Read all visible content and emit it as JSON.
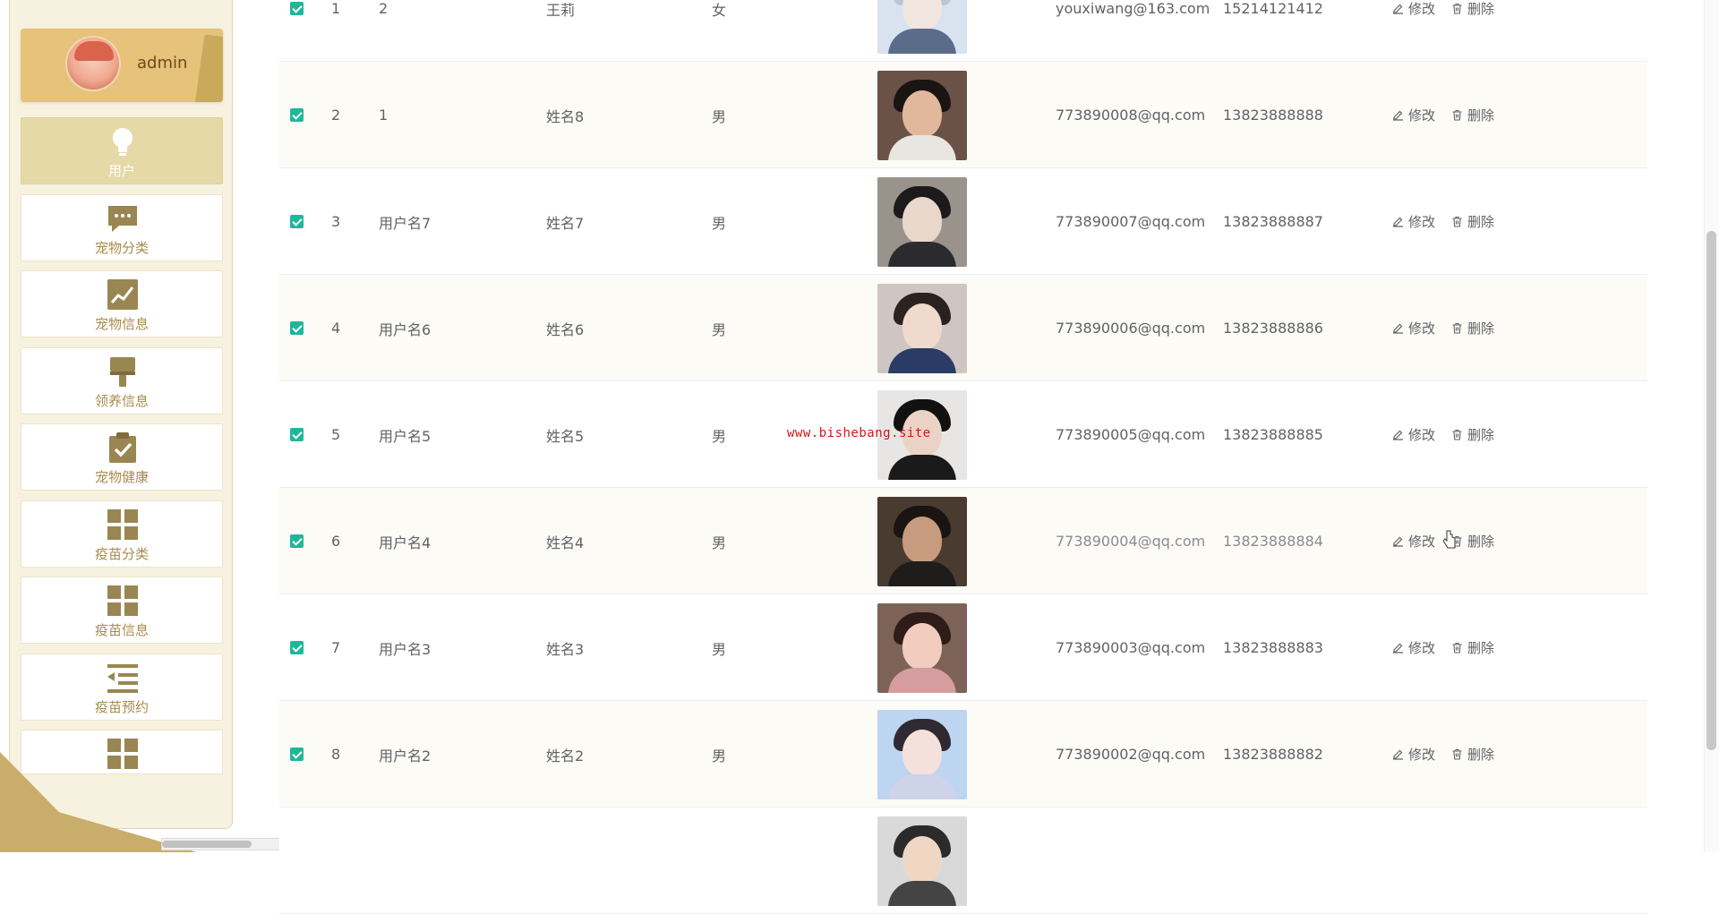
{
  "sidebar": {
    "user": {
      "name": "admin"
    },
    "items": [
      {
        "label": "用户",
        "icon": "lightbulb-icon",
        "active": true
      },
      {
        "label": "宠物分类",
        "icon": "chat-bubble-icon"
      },
      {
        "label": "宠物信息",
        "icon": "trend-chart-icon"
      },
      {
        "label": "领养信息",
        "icon": "paint-brush-icon"
      },
      {
        "label": "宠物健康",
        "icon": "clipboard-check-icon"
      },
      {
        "label": "疫苗分类",
        "icon": "grid-icon"
      },
      {
        "label": "疫苗信息",
        "icon": "grid-icon"
      },
      {
        "label": "疫苗预约",
        "icon": "indent-list-icon"
      },
      {
        "label": "",
        "icon": "grid-icon"
      }
    ]
  },
  "table": {
    "rows": [
      {
        "index": "1",
        "account": "2",
        "name": "王莉",
        "gender": "女",
        "email": "youxiwang@163.com",
        "phone": "15214121412"
      },
      {
        "index": "2",
        "account": "1",
        "name": "姓名8",
        "gender": "男",
        "email": "773890008@qq.com",
        "phone": "13823888888"
      },
      {
        "index": "3",
        "account": "用户名7",
        "name": "姓名7",
        "gender": "男",
        "email": "773890007@qq.com",
        "phone": "13823888887"
      },
      {
        "index": "4",
        "account": "用户名6",
        "name": "姓名6",
        "gender": "男",
        "email": "773890006@qq.com",
        "phone": "13823888886"
      },
      {
        "index": "5",
        "account": "用户名5",
        "name": "姓名5",
        "gender": "男",
        "email": "773890005@qq.com",
        "phone": "13823888885"
      },
      {
        "index": "6",
        "account": "用户名4",
        "name": "姓名4",
        "gender": "男",
        "email": "773890004@qq.com",
        "phone": "13823888884"
      },
      {
        "index": "7",
        "account": "用户名3",
        "name": "姓名3",
        "gender": "男",
        "email": "773890003@qq.com",
        "phone": "13823888883"
      },
      {
        "index": "8",
        "account": "用户名2",
        "name": "姓名2",
        "gender": "男",
        "email": "773890002@qq.com",
        "phone": "13823888882"
      },
      {
        "index": "",
        "account": "",
        "name": "",
        "gender": "",
        "email": "",
        "phone": ""
      }
    ],
    "actions": {
      "edit": "修改",
      "delete": "删除"
    }
  },
  "watermark": "www.bishebang.site",
  "colors": {
    "accent": "#1fb79a",
    "sidebar_bg": "#f7f2df",
    "sidebar_text": "#a88b4e",
    "active_item": "#e6d9a8",
    "watermark": "#d2141c"
  }
}
